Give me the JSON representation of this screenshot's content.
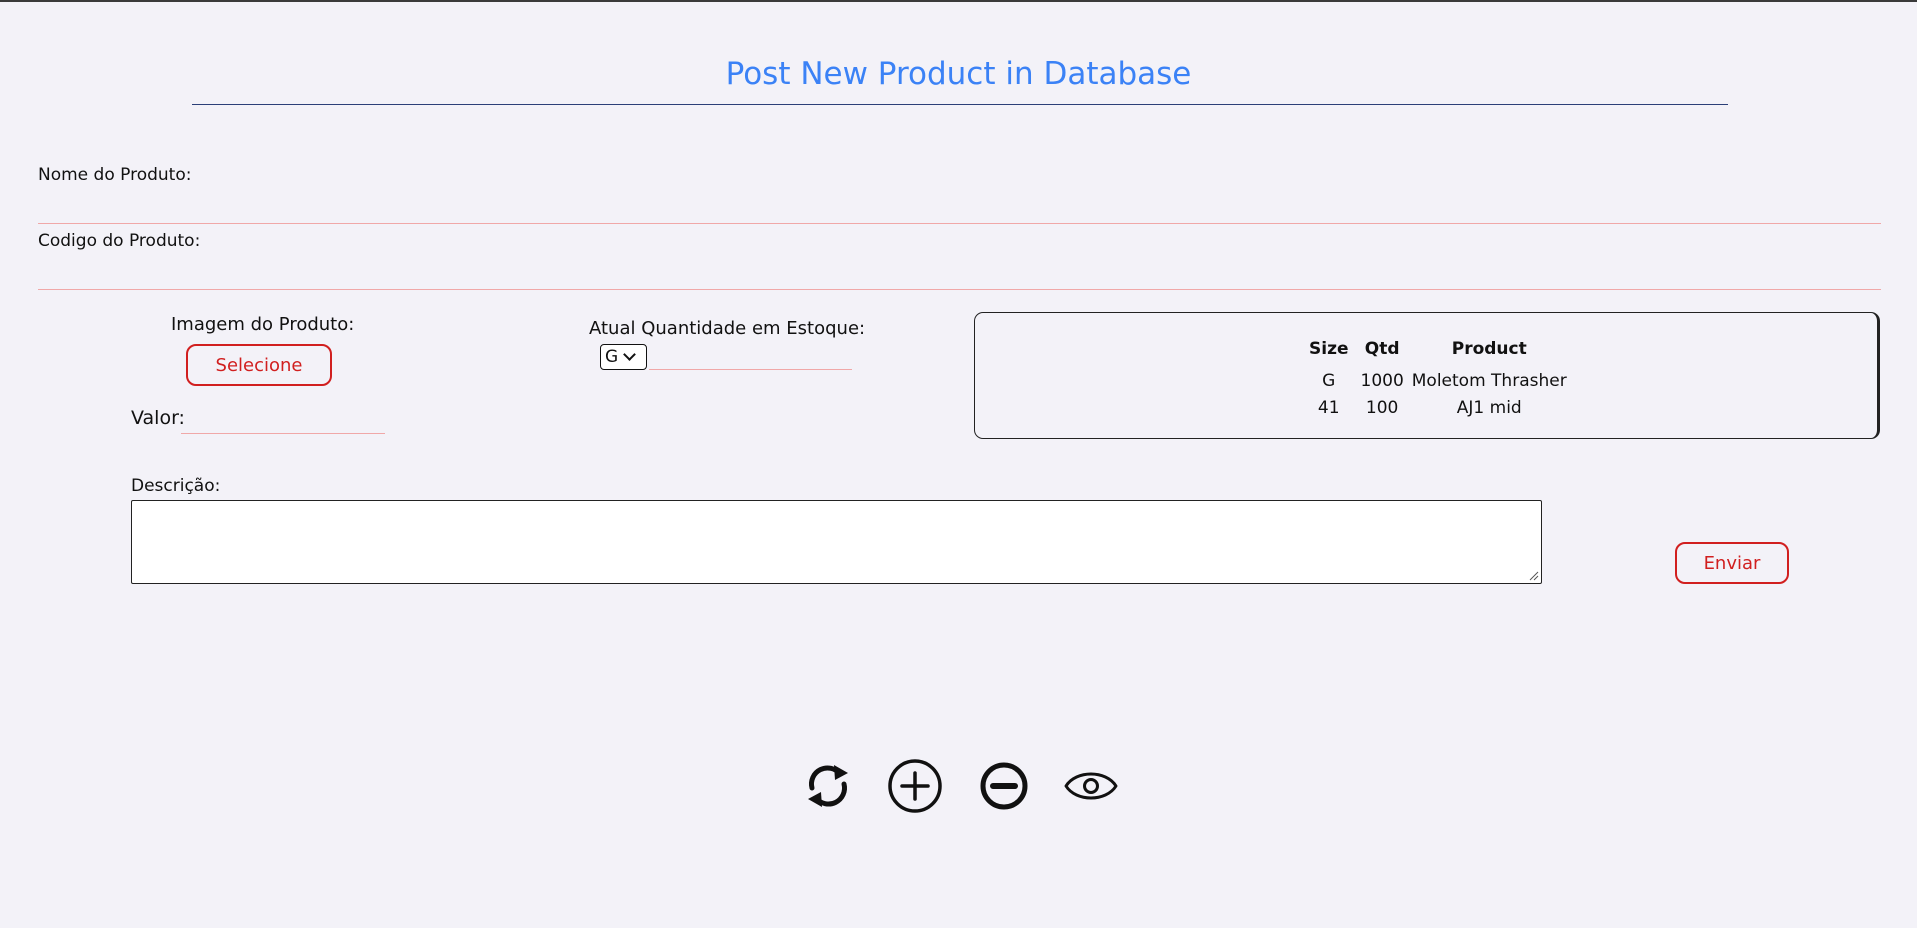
{
  "page": {
    "title": "Post New Product in Database"
  },
  "form": {
    "name_label": "Nome do Produto:",
    "name_value": "",
    "code_label": "Codigo do Produto:",
    "code_value": "",
    "image_label": "Imagem do Produto:",
    "select_button_label": "Selecione",
    "value_label": "Valor:",
    "value_value": "",
    "stock_label": "Atual Quantidade em Estoque:",
    "stock_size_selected": "G",
    "stock_qty_value": "",
    "description_label": "Descrição:",
    "description_value": "",
    "submit_label": "Enviar"
  },
  "stock_table": {
    "headers": [
      "Size",
      "Qtd",
      "Product"
    ],
    "rows": [
      [
        "G",
        "1000",
        "Moletom Thrasher"
      ],
      [
        "41",
        "100",
        "AJ1 mid"
      ]
    ]
  },
  "toolbar": {
    "icons": [
      "refresh-icon",
      "plus-circle-icon",
      "minus-circle-icon",
      "eye-icon"
    ]
  },
  "colors": {
    "accent": "#3b82f6",
    "button_red": "#d11f1f",
    "underline": "#f0a8a8",
    "background": "#f3f2f8"
  }
}
